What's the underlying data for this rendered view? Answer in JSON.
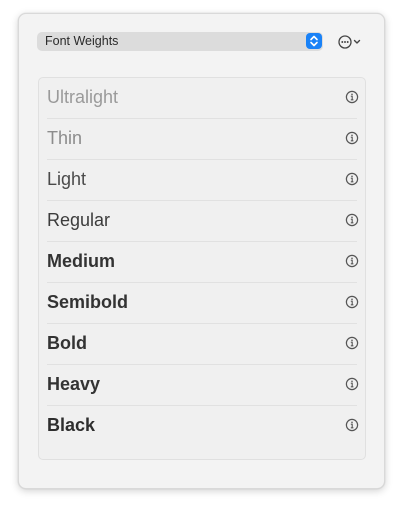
{
  "toolbar": {
    "popup_label": "Font Weights",
    "popup_icon": "up-down-chevron-icon",
    "more_icon": "ellipsis-circle-icon",
    "accent_color": "#1a82f7"
  },
  "list": {
    "items": [
      {
        "label": "Ultralight",
        "icon": "info-circle-icon"
      },
      {
        "label": "Thin",
        "icon": "info-circle-icon"
      },
      {
        "label": "Light",
        "icon": "info-circle-icon"
      },
      {
        "label": "Regular",
        "icon": "info-circle-icon"
      },
      {
        "label": "Medium",
        "icon": "info-circle-icon"
      },
      {
        "label": "Semibold",
        "icon": "info-circle-icon"
      },
      {
        "label": "Bold",
        "icon": "info-circle-icon"
      },
      {
        "label": "Heavy",
        "icon": "info-circle-icon"
      },
      {
        "label": "Black",
        "icon": "info-circle-icon"
      }
    ]
  }
}
